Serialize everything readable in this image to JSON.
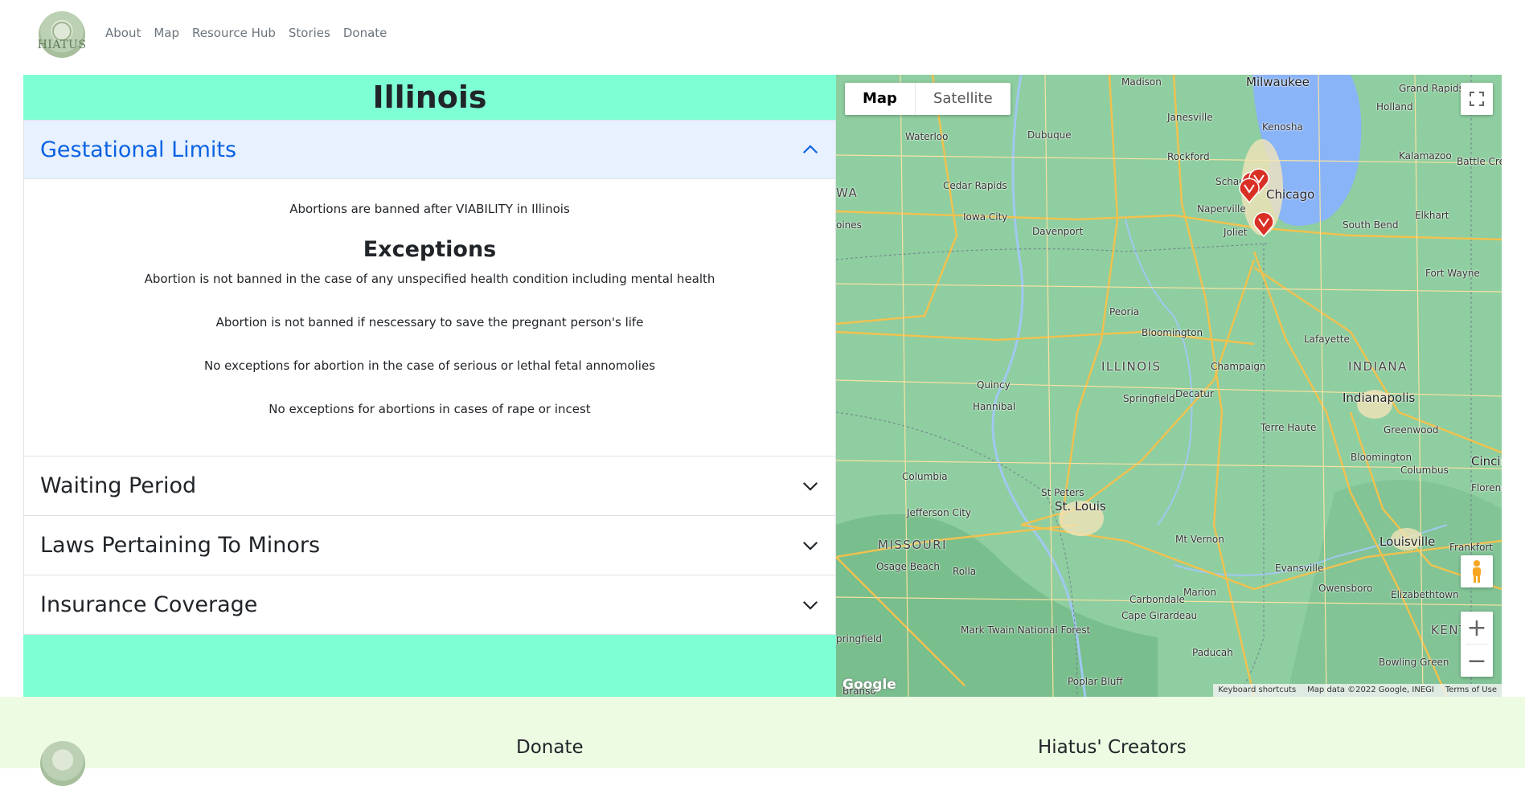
{
  "nav": {
    "logo_text": "HIATUS",
    "links": [
      "About",
      "Map",
      "Resource Hub",
      "Stories",
      "Donate"
    ]
  },
  "state": {
    "title": "Illinois"
  },
  "accordion": {
    "sections": [
      {
        "title": "Gestational Limits",
        "expanded": true
      },
      {
        "title": "Waiting Period",
        "expanded": false
      },
      {
        "title": "Laws Pertaining To Minors",
        "expanded": false
      },
      {
        "title": "Insurance Coverage",
        "expanded": false
      }
    ],
    "gestational": {
      "ban_text": "Abortions are banned after VIABILITY in Illinois",
      "exceptions_title": "Exceptions",
      "exceptions": [
        "Abortion is not banned in the case of any unspecified health condition including mental health",
        "Abortion is not banned if nescessary to save the pregnant person's life",
        "No exceptions for abortion in the case of serious or lethal fetal annomolies",
        "No exceptions for abortions in cases of rape or incest"
      ]
    }
  },
  "map": {
    "type_buttons": [
      "Map",
      "Satellite"
    ],
    "active_type": "Map",
    "zoom_in": "+",
    "zoom_out": "−",
    "attribution": [
      "Keyboard shortcuts",
      "Map data ©2022 Google, INEGI",
      "Terms of Use"
    ],
    "google_logo": "Google",
    "labels": {
      "madison": "Madison",
      "milwaukee": "Milwaukee",
      "grand_rapids": "Grand Rapids",
      "holland": "Holland",
      "waterloo": "Waterloo",
      "dubuque": "Dubuque",
      "janesville": "Janesville",
      "kenosha": "Kenosha",
      "rockford": "Rockford",
      "kalamazoo": "Kalamazoo",
      "battle_creek": "Battle Creek",
      "cedar_rapids": "Cedar Rapids",
      "iowa": "WA",
      "schaumburg": "Schaum",
      "chicago": "Chicago",
      "naperville": "Naperville",
      "elkhart": "Elkhart",
      "iowa_city": "Iowa City",
      "moines": "oines",
      "davenport": "Davenport",
      "joliet": "Joliet",
      "south_bend": "South Bend",
      "fort_wayne": "Fort Wayne",
      "peoria": "Peoria",
      "bloomington_il": "Bloomington",
      "lafayette": "Lafayette",
      "illinois": "ILLINOIS",
      "champaign": "Champaign",
      "indiana": "INDIANA",
      "quincy": "Quincy",
      "decatur": "Decatur",
      "indianapolis": "Indianapolis",
      "hannibal": "Hannibal",
      "springfield": "Springfield",
      "terre_haute": "Terre Haute",
      "greenwood": "Greenwood",
      "bloomington_in": "Bloomington",
      "columbus": "Columbus",
      "cincinnati": "Cincir",
      "columbia": "Columbia",
      "florence": "Florenc",
      "st_peters": "St Peters",
      "st_louis": "St. Louis",
      "jefferson_city": "Jefferson City",
      "missouri": "MISSOURI",
      "mt_vernon": "Mt Vernon",
      "louisville": "Louisville",
      "frankfort": "Frankfort",
      "evansville": "Evansville",
      "osage_beach": "Osage Beach",
      "rolla": "Rolla",
      "owensboro": "Owensboro",
      "elizabethtown": "Elizabethtown",
      "marion": "Marion",
      "carbondale": "Carbondale",
      "cape_girardeau": "Cape Girardeau",
      "kentucky": "KENT",
      "springfield_mo": "pringfield",
      "mark_twain": "Mark Twain National Forest",
      "paducah": "Paducah",
      "bowling_green": "Bowling Green",
      "poplar_bluff": "Poplar Bluff",
      "branson": "Branso"
    }
  },
  "footer": {
    "donate_heading": "Donate",
    "creators_heading": "Hiatus' Creators"
  }
}
